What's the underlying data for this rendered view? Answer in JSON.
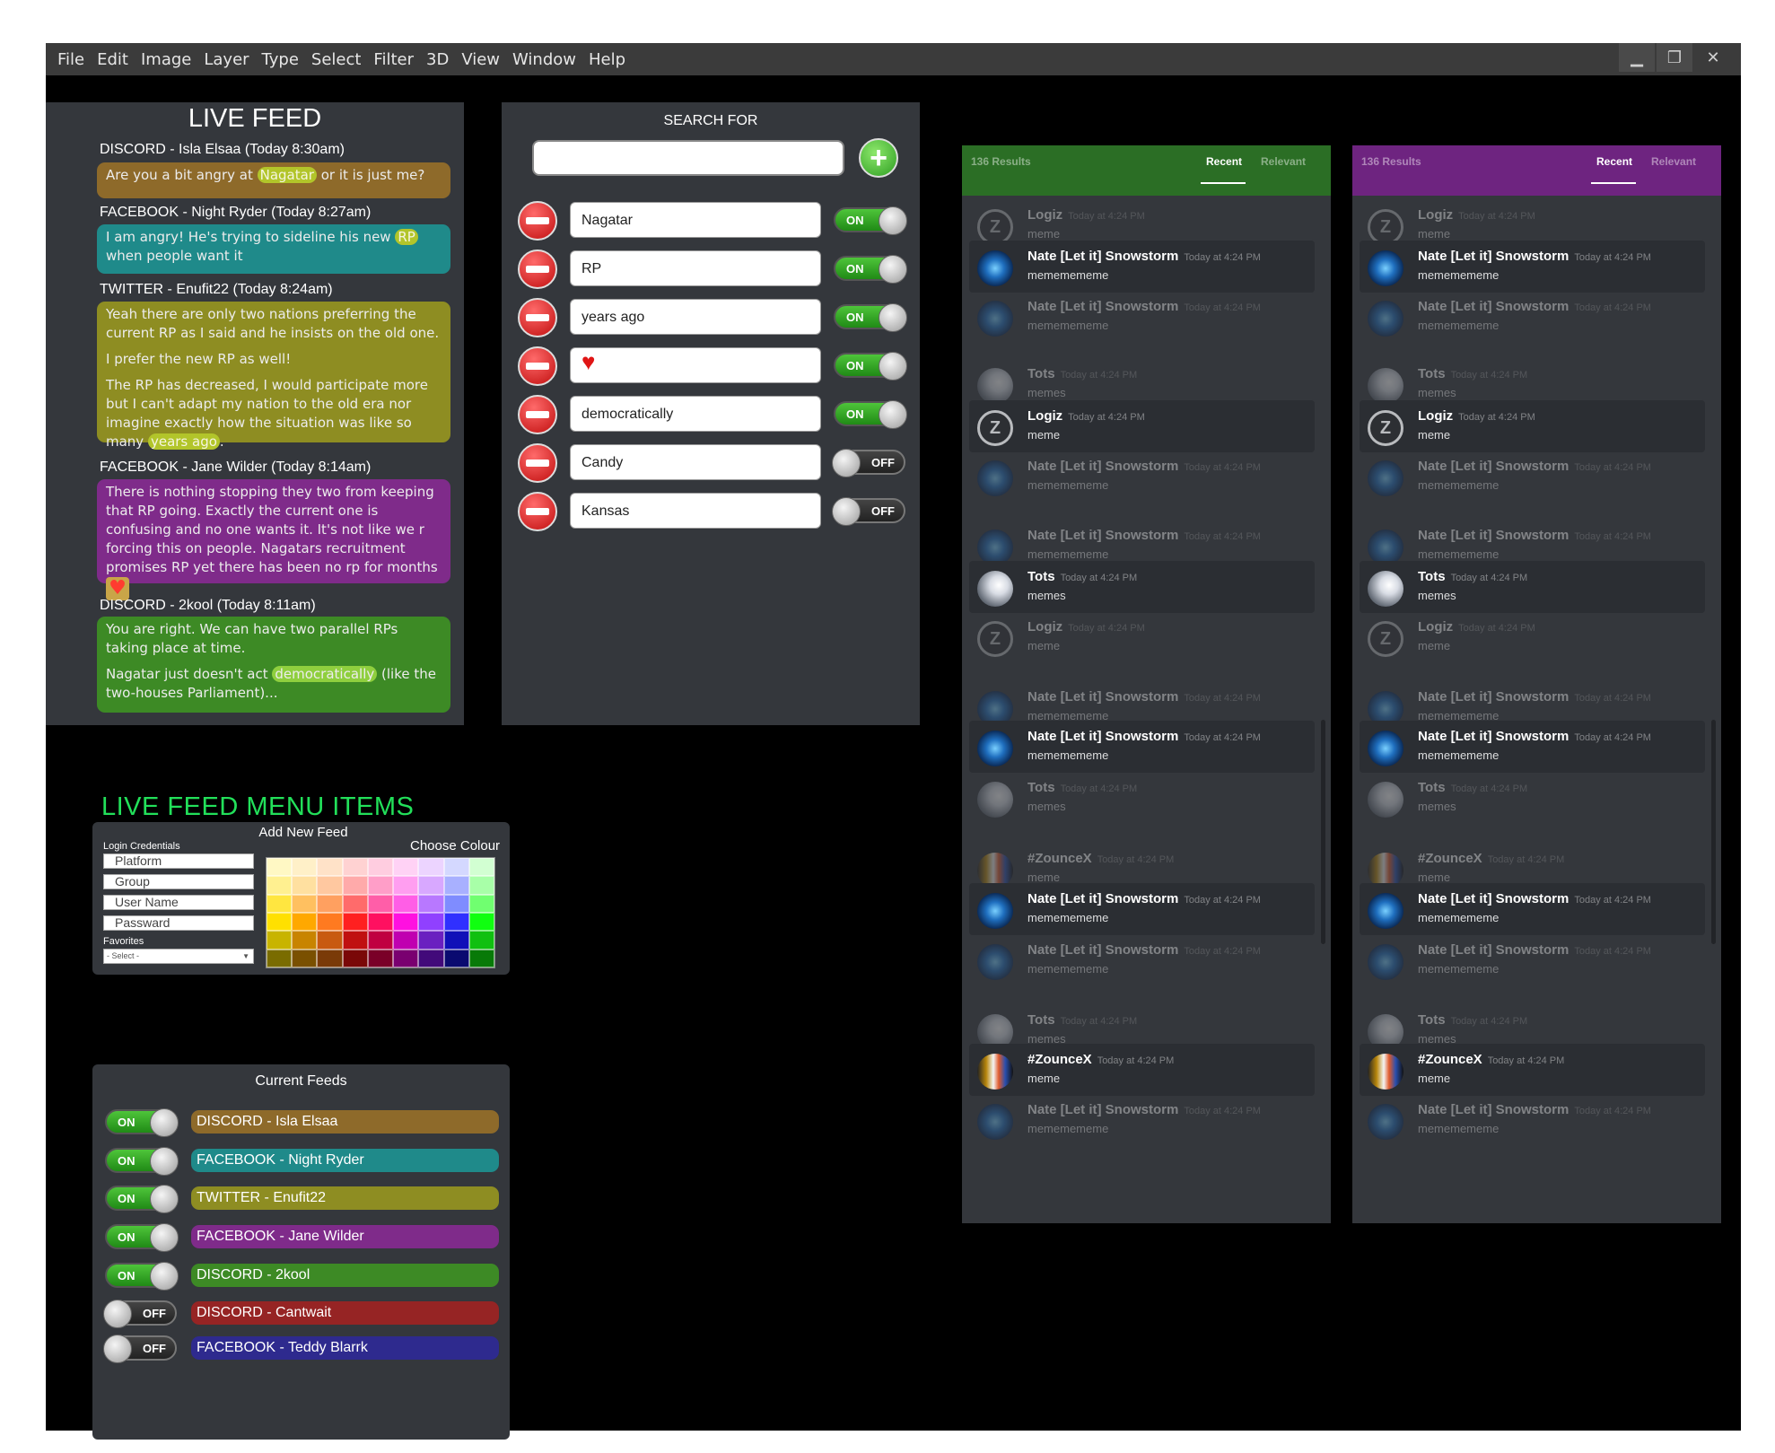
{
  "menubar": {
    "items": [
      "File",
      "Edit",
      "Image",
      "Layer",
      "Type",
      "Select",
      "Filter",
      "3D",
      "View",
      "Window",
      "Help"
    ],
    "controls": {
      "minimize": "▁",
      "restore": "❐",
      "close": "✕"
    }
  },
  "live_feed": {
    "title": "LIVE FEED",
    "entries": [
      {
        "header": "DISCORD - Isla Elsaa   (Today 8:30am)",
        "color": "#8e6a2a",
        "paragraphs": [
          [
            "Are you a bit angry at ",
            {
              "hl": "Nagatar"
            },
            " or it is just me?"
          ]
        ]
      },
      {
        "header": "FACEBOOK - Night Ryder   (Today 8:27am)",
        "color": "#1f8a8a",
        "paragraphs": [
          [
            "I am angry! He's trying to sideline his new ",
            {
              "hl": "RP"
            },
            " when people want it"
          ]
        ]
      },
      {
        "header": "TWITTER - Enufit22   (Today 8:24am)",
        "color": "#8e8d22",
        "paragraphs": [
          [
            "Yeah there are only two nations preferring the current RP as I said and he insists on the old one."
          ],
          [
            "I prefer the new RP as well!"
          ],
          [
            "The RP has decreased, I would participate more but I can't adapt my nation to the old era nor imagine exactly how the situation was like so many ",
            {
              "hl": "years ago"
            },
            "."
          ]
        ]
      },
      {
        "header": "FACEBOOK - Jane Wilder   (Today 8:14am)",
        "color": "#7f2b8a",
        "paragraphs": [
          [
            "There is nothing stopping they two from keeping that RP going. Exactly the current one is confusing and no one wants it. It's not like we r forcing this on people. Nagatars recruitment promises RP yet there has been no rp for months ",
            {
              "heart": "♥"
            }
          ]
        ]
      },
      {
        "header": "DISCORD - 2kool   (Today 8:11am)",
        "color": "#3d8a25",
        "paragraphs": [
          [
            "You are right. We can have two parallel RPs taking place at time."
          ],
          [
            "Nagatar just doesn't act ",
            {
              "hl": "democratically"
            },
            " (like the two-houses Parliament)..."
          ]
        ]
      }
    ]
  },
  "search": {
    "label": "SEARCH FOR",
    "input_value": "",
    "add_icon": "+",
    "keywords": [
      {
        "text": "Nagatar",
        "state": "ON"
      },
      {
        "text": "RP",
        "state": "ON"
      },
      {
        "text": "years ago",
        "state": "ON"
      },
      {
        "text": "",
        "icon": "heart-icon",
        "glyph": "♥",
        "state": "ON"
      },
      {
        "text": "democratically",
        "state": "ON"
      },
      {
        "text": "Candy",
        "state": "OFF"
      },
      {
        "text": "Kansas",
        "state": "OFF"
      }
    ]
  },
  "menu_items": {
    "title": "LIVE FEED MENU  ITEMS",
    "add_new_feed": {
      "title": "Add New Feed",
      "login_label": "Login Credentials",
      "fields": [
        "Platform",
        "Group",
        "User Name",
        "Passward"
      ],
      "favorites_label": "Favorites",
      "favorites_select": "- Select -",
      "choose_colour_label": "Choose Colour",
      "palette_rows": [
        [
          "#fff8c4",
          "#fff0c8",
          "#ffe2c8",
          "#ffd2d2",
          "#ffcde0",
          "#ffd2f5",
          "#ecd4ff",
          "#d4d8ff",
          "#d2ffd2"
        ],
        [
          "#fff090",
          "#ffe0a0",
          "#ffc8a0",
          "#ffaaaa",
          "#ff9ec8",
          "#ff9ef0",
          "#d8a8ff",
          "#a8b0ff",
          "#a8ffa8"
        ],
        [
          "#ffe640",
          "#ffc060",
          "#ffa060",
          "#ff6b6b",
          "#ff5ea8",
          "#ff5ee6",
          "#b878ff",
          "#7f8cff",
          "#70ff70"
        ],
        [
          "#ffe000",
          "#ffa800",
          "#ff7a20",
          "#ff2020",
          "#ff1060",
          "#ff10e0",
          "#9040ff",
          "#3030ff",
          "#10ff10"
        ],
        [
          "#c8b400",
          "#c88400",
          "#c85a10",
          "#c01010",
          "#c00040",
          "#c000b0",
          "#6a20c0",
          "#1010b8",
          "#10c010"
        ],
        [
          "#7a6c00",
          "#7a5000",
          "#7a3a08",
          "#7a0808",
          "#7a0028",
          "#7a0070",
          "#420a7a",
          "#0a0a70",
          "#087a08"
        ]
      ]
    },
    "current_feeds": {
      "title": "Current Feeds",
      "feeds": [
        {
          "name": "DISCORD - Isla Elsaa",
          "state": "ON",
          "color": "#8e6a2a"
        },
        {
          "name": "FACEBOOK - Night Ryder",
          "state": "ON",
          "color": "#1f8a8a"
        },
        {
          "name": "TWITTER - Enufit22",
          "state": "ON",
          "color": "#8e8d22"
        },
        {
          "name": "FACEBOOK - Jane Wilder",
          "state": "ON",
          "color": "#7f2b8a"
        },
        {
          "name": "DISCORD - 2kool",
          "state": "ON",
          "color": "#3d8a25"
        },
        {
          "name": "DISCORD - Cantwait",
          "state": "OFF",
          "color": "#962424"
        },
        {
          "name": "FACEBOOK - Teddy Blarrk",
          "state": "OFF",
          "color": "#2e2a8e"
        }
      ]
    }
  },
  "discord_panels": [
    {
      "header_color": "#2b6e25",
      "results": "136 Results",
      "tab_recent": "Recent",
      "tab_relevant": "Relevant"
    },
    {
      "header_color": "#6e2480",
      "results": "136 Results",
      "tab_recent": "Recent",
      "tab_relevant": "Relevant"
    }
  ],
  "discord_messages": [
    {
      "name": "Logiz",
      "time": "Today at 4:24 PM",
      "text": "meme",
      "avatar": "logiz",
      "style": "dim"
    },
    {
      "name": "Nate [Let it] Snowstorm",
      "time": "Today at 4:24 PM",
      "text": "mememememe",
      "avatar": "nate",
      "style": "hl"
    },
    {
      "name": "Nate [Let it] Snowstorm",
      "time": "Today at 4:24 PM",
      "text": "mememememe",
      "avatar": "nate",
      "style": "dim"
    },
    {
      "name": "Tots",
      "time": "Today at 4:24 PM",
      "text": "memes",
      "avatar": "tots",
      "style": "dim"
    },
    {
      "name": "Logiz",
      "time": "Today at 4:24 PM",
      "text": "meme",
      "avatar": "logiz",
      "style": "hl"
    },
    {
      "name": "Nate [Let it] Snowstorm",
      "time": "Today at 4:24 PM",
      "text": "mememememe",
      "avatar": "nate",
      "style": "dim"
    },
    {
      "name": "Nate [Let it] Snowstorm",
      "time": "Today at 4:24 PM",
      "text": "mememememe",
      "avatar": "nate",
      "style": "dim"
    },
    {
      "name": "Tots",
      "time": "Today at 4:24 PM",
      "text": "memes",
      "avatar": "tots",
      "style": "hl"
    },
    {
      "name": "Logiz",
      "time": "Today at 4:24 PM",
      "text": "meme",
      "avatar": "logiz",
      "style": "dim"
    },
    {
      "name": "Nate [Let it] Snowstorm",
      "time": "Today at 4:24 PM",
      "text": "mememememe",
      "avatar": "nate",
      "style": "dim"
    },
    {
      "name": "Nate [Let it] Snowstorm",
      "time": "Today at 4:24 PM",
      "text": "mememememe",
      "avatar": "nate",
      "style": "hl"
    },
    {
      "name": "Tots",
      "time": "Today at 4:24 PM",
      "text": "memes",
      "avatar": "tots",
      "style": "dim"
    },
    {
      "name": "#ZounceX",
      "time": "Today at 4:24 PM",
      "text": "meme",
      "avatar": "zounce",
      "style": "dim"
    },
    {
      "name": "Nate [Let it] Snowstorm",
      "time": "Today at 4:24 PM",
      "text": "mememememe",
      "avatar": "nate",
      "style": "hl"
    },
    {
      "name": "Nate [Let it] Snowstorm",
      "time": "Today at 4:24 PM",
      "text": "mememememe",
      "avatar": "nate",
      "style": "dim"
    },
    {
      "name": "Tots",
      "time": "Today at 4:24 PM",
      "text": "memes",
      "avatar": "tots",
      "style": "dim"
    },
    {
      "name": "#ZounceX",
      "time": "Today at 4:24 PM",
      "text": "meme",
      "avatar": "zounce",
      "style": "hl"
    },
    {
      "name": "Nate [Let it] Snowstorm",
      "time": "Today at 4:24 PM",
      "text": "mememememe",
      "avatar": "nate",
      "style": "dim"
    }
  ]
}
